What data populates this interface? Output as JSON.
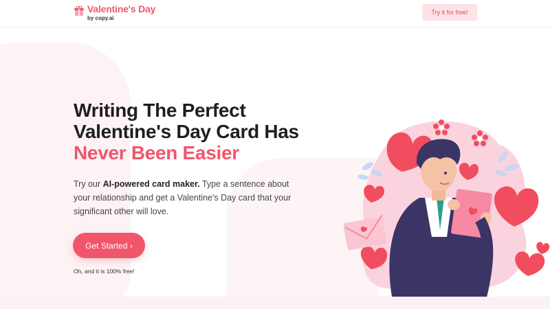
{
  "header": {
    "brand_title": "Valentine's Day",
    "brand_sub": "by copy.ai",
    "try_label": "Try it for free!"
  },
  "hero": {
    "headline_line1": "Writing The Perfect",
    "headline_line2": "Valentine's Day Card Has",
    "headline_accent": "Never Been Easier",
    "desc_prefix": "Try our ",
    "desc_bold": "AI-powered card maker.",
    "desc_rest": " Type a sentence about your relationship and get a Valentine's Day card that your significant other will love.",
    "cta_label": "Get Started ›",
    "note": "Oh, and it is 100% free!"
  },
  "colors": {
    "accent": "#f0566a",
    "soft_pink": "#fde3e5",
    "blob": "#fdf2f4",
    "navy": "#3b3566"
  },
  "icons": [
    "gift-icon",
    "heart-icon",
    "flower-icon",
    "envelope-icon",
    "leaf-icon"
  ]
}
